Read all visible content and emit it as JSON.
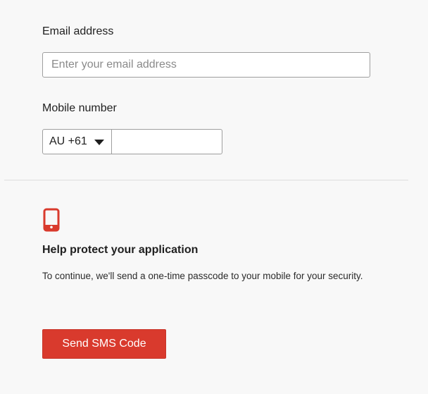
{
  "email": {
    "label": "Email address",
    "placeholder": "Enter your email address",
    "value": ""
  },
  "mobile": {
    "label": "Mobile number",
    "country_code": "AU +61",
    "value": ""
  },
  "security": {
    "icon": "mobile-phone-icon",
    "icon_color": "#d93a2d",
    "heading": "Help protect your application",
    "description": "To continue, we'll send a one-time passcode to your mobile for your security."
  },
  "actions": {
    "send_label": "Send SMS Code",
    "send_color": "#d93a2d"
  }
}
